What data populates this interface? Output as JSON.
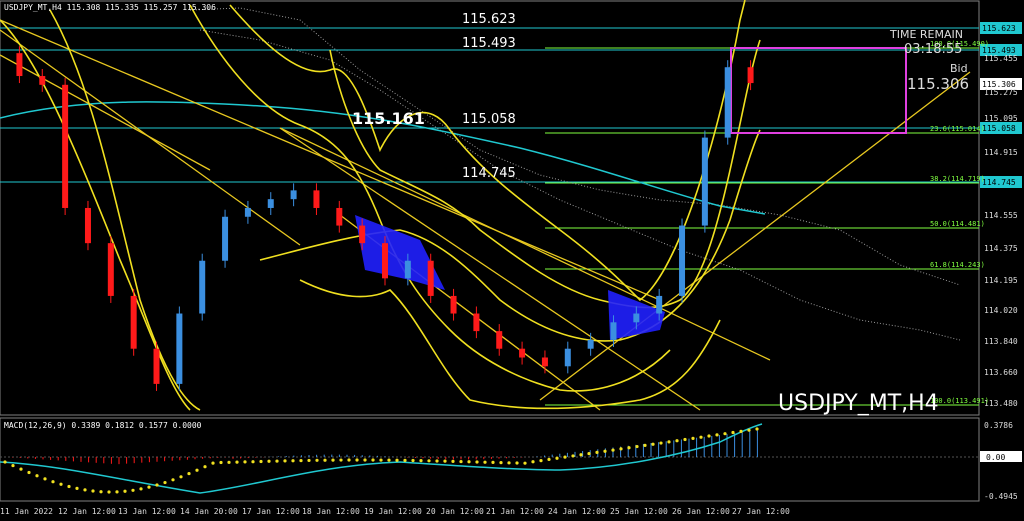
{
  "chart": {
    "header": "USDJPY_MT,H4  115.308 115.335 115.257 115.306",
    "watermark": "USDJPY_MT,H4",
    "time_remain_label": "TIME REMAIN",
    "time_remain_value": "03:18:55",
    "bid_label": "Bid",
    "bid_value": "115.306",
    "highlight_label": "115.161",
    "level_labels": [
      "115.623",
      "115.493",
      "115.058",
      "114.745"
    ],
    "price_axis": [
      "115.623",
      "115.493",
      "115.455",
      "115.306",
      "115.275",
      "115.095",
      "115.058",
      "114.915",
      "114.745",
      "114.555",
      "114.375",
      "114.195",
      "114.020",
      "113.840",
      "113.660",
      "113.480"
    ],
    "fib_labels": [
      "100.0(115.490)",
      "23.6(115.014)",
      "38.2(114.719)",
      "50.0(114.481)",
      "61.8(114.243)",
      "100.0(113.491)"
    ],
    "x_axis": [
      "11 Jan 2022",
      "12 Jan 12:00",
      "13 Jan 12:00",
      "14 Jan 20:00",
      "17 Jan 12:00",
      "18 Jan 12:00",
      "19 Jan 12:00",
      "20 Jan 12:00",
      "21 Jan 12:00",
      "24 Jan 12:00",
      "25 Jan 12:00",
      "26 Jan 12:00",
      "27 Jan 12:00"
    ],
    "macd_label": "MACD(12,26,9) 0.3389 0.1812 0.1577 0.0000",
    "macd_axis": [
      "0.3786",
      "0.00",
      "-0.4945"
    ],
    "colors": {
      "background": "#000000",
      "bull": "#3b8fe0",
      "bear": "#ff1a1a",
      "bollinger": "#f0e020",
      "ma_cyan": "#20c8d0",
      "fib": "#80ff40",
      "magenta": "#e040e0",
      "cloud": "#b0b0b0"
    }
  },
  "chart_data": {
    "type": "candlestick",
    "symbol": "USDJPY_MT",
    "timeframe": "H4",
    "x": [
      "11 Jan 2022",
      "12 Jan 12:00",
      "13 Jan 12:00",
      "14 Jan 20:00",
      "17 Jan 12:00",
      "18 Jan 12:00",
      "19 Jan 12:00",
      "20 Jan 12:00",
      "21 Jan 12:00",
      "24 Jan 12:00",
      "25 Jan 12:00",
      "26 Jan 12:00",
      "27 Jan 12:00"
    ],
    "close_path": [
      115.48,
      115.35,
      115.3,
      114.6,
      114.4,
      114.1,
      113.8,
      113.6,
      114.0,
      114.3,
      114.55,
      114.6,
      114.65,
      114.7,
      114.6,
      114.5,
      114.4,
      114.2,
      114.3,
      114.1,
      114.0,
      113.9,
      113.8,
      113.75,
      113.7,
      113.8,
      113.85,
      113.95,
      114.0,
      114.1,
      114.5,
      115.0,
      115.4,
      115.31
    ],
    "ylim": [
      113.48,
      115.623
    ],
    "levels": [
      115.623,
      115.493,
      115.058,
      114.745
    ],
    "macd_ylim": [
      -0.4945,
      0.3786
    ]
  }
}
